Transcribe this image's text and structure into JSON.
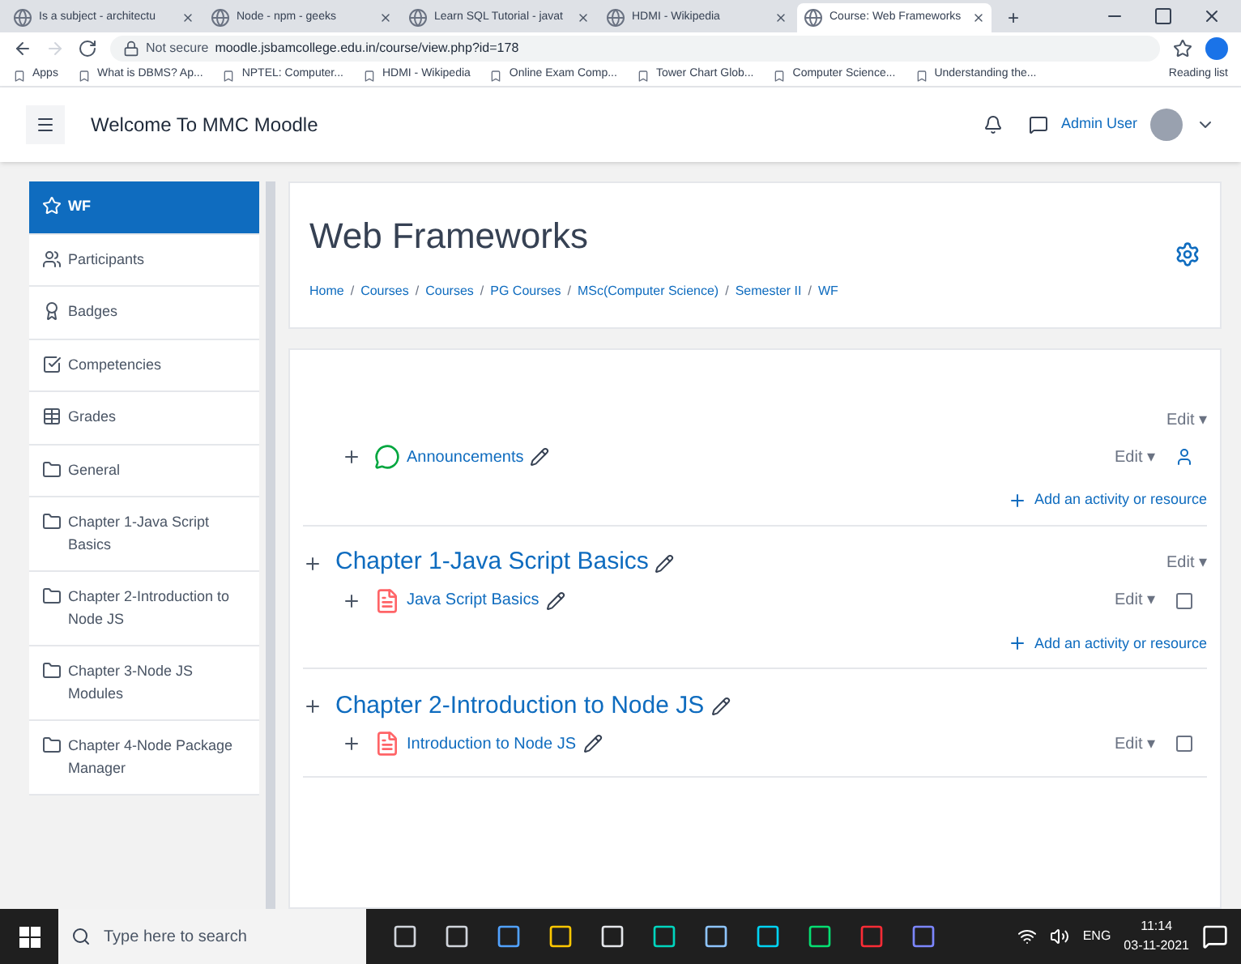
{
  "browser": {
    "tabs": [
      {
        "title": "Is a subject - architectu",
        "selected": false
      },
      {
        "title": "Node - npm - geeks",
        "selected": false
      },
      {
        "title": "Learn SQL Tutorial - javat",
        "selected": false
      },
      {
        "title": "HDMI - Wikipedia",
        "selected": false
      },
      {
        "title": "Course: Web Frameworks",
        "selected": true
      }
    ],
    "new_tab": "+",
    "address": {
      "security": "Not secure",
      "url": "moodle.jsbamcollege.edu.in/course/view.php?id=178"
    },
    "bookmarks": [
      "Apps",
      "What is DBMS? Ap...",
      "NPTEL: Computer...",
      "HDMI - Wikipedia",
      "Online Exam Comp...",
      "Tower Chart Glob...",
      "Computer Science...",
      "Understanding the..."
    ],
    "reading_list": "Reading list"
  },
  "header": {
    "site_name": "Welcome To MMC Moodle",
    "user_name": "Admin User"
  },
  "sidebar": {
    "items": [
      {
        "label": "WF",
        "kind": "course",
        "selected": true
      },
      {
        "label": "Participants",
        "kind": "people",
        "selected": false
      },
      {
        "label": "Badges",
        "kind": "badge",
        "selected": false
      },
      {
        "label": "Competencies",
        "kind": "check",
        "selected": false
      },
      {
        "label": "Grades",
        "kind": "grid",
        "selected": false
      },
      {
        "label": "General",
        "kind": "folder",
        "selected": false
      },
      {
        "label": "Chapter 1-Java Script Basics",
        "kind": "folder",
        "selected": false
      },
      {
        "label": "Chapter 2-Introduction to Node JS",
        "kind": "folder",
        "selected": false
      },
      {
        "label": "Chapter 3-Node JS Modules",
        "kind": "folder",
        "selected": false
      },
      {
        "label": "Chapter 4-Node Package Manager",
        "kind": "folder",
        "selected": false
      }
    ]
  },
  "course": {
    "title": "Web Frameworks",
    "breadcrumb_separator": "/",
    "breadcrumb": [
      "Home",
      "Courses",
      "Courses",
      "PG Courses",
      "MSc(Computer Science)",
      "Semester II",
      "WF"
    ]
  },
  "sections": [
    {
      "edit": "Edit ▾",
      "activities": [
        {
          "name": "Announcements",
          "kind": "forum",
          "edit": "Edit ▾"
        }
      ],
      "add": "Add an activity or resource"
    },
    {
      "title": "Chapter 1-Java Script Basics",
      "edit": "Edit ▾",
      "activities": [
        {
          "name": "Java Script Basics",
          "kind": "file",
          "edit": "Edit ▾"
        }
      ],
      "add": "Add an activity or resource"
    },
    {
      "title": "Chapter 2-Introduction to Node JS",
      "activities": [
        {
          "name": "Introduction to Node JS",
          "kind": "file",
          "edit": "Edit ▾"
        }
      ]
    }
  ],
  "taskbar": {
    "search_placeholder": "Type here to search",
    "language": "ENG",
    "time": "11:14",
    "date": "03-11-2021"
  }
}
